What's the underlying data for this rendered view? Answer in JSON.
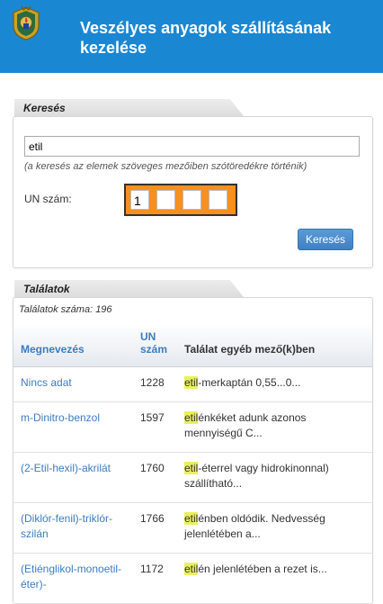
{
  "header": {
    "title": "Veszélyes anyagok szállításának kezelése",
    "logo": "fire-department-emblem-icon"
  },
  "search": {
    "panel_title": "Keresés",
    "input_value": "etil",
    "hint": "(a keresés az elemek szöveges mezőiben szótöredékre történik)",
    "un_label": "UN szám:",
    "un_digits": [
      "1",
      "",
      "",
      ""
    ],
    "button_label": "Keresés"
  },
  "results": {
    "panel_title": "Találatok",
    "count_text": "Találatok száma: 196",
    "headers": {
      "name": "Megnevezés",
      "un_line1": "UN",
      "un_line2": "szám",
      "match": "Találat egyéb mező(k)ben"
    },
    "rows": [
      {
        "name": "Nincs adat",
        "un": "1228",
        "match_hl": "etil",
        "match_rest": "-merkaptán 0,55...0..."
      },
      {
        "name": "m-Dinitro-benzol",
        "un": "1597",
        "match_hl": "etil",
        "match_rest": "énkéket adunk azonos mennyiségű C..."
      },
      {
        "name": "(2-Etil-hexil)-akrilát",
        "un": "1760",
        "match_hl": "etil",
        "match_rest": "-éterrel vagy hidrokinonnal) szállítható..."
      },
      {
        "name": "(Diklór-fenil)-triklór-szilán",
        "un": "1766",
        "match_hl": "etil",
        "match_rest": "énben oldódik. Nedvesség jelenlétében a..."
      },
      {
        "name": "(Etiénglikol-monoetil-éter)-",
        "un": "1172",
        "match_hl": "etil",
        "match_rest": "én jelenlétében a rezet is..."
      }
    ]
  },
  "colors": {
    "header_bg": "#1a87d3",
    "un_box_bg": "#f7901e",
    "highlight": "#eaf05c",
    "link": "#3d7cc0"
  }
}
